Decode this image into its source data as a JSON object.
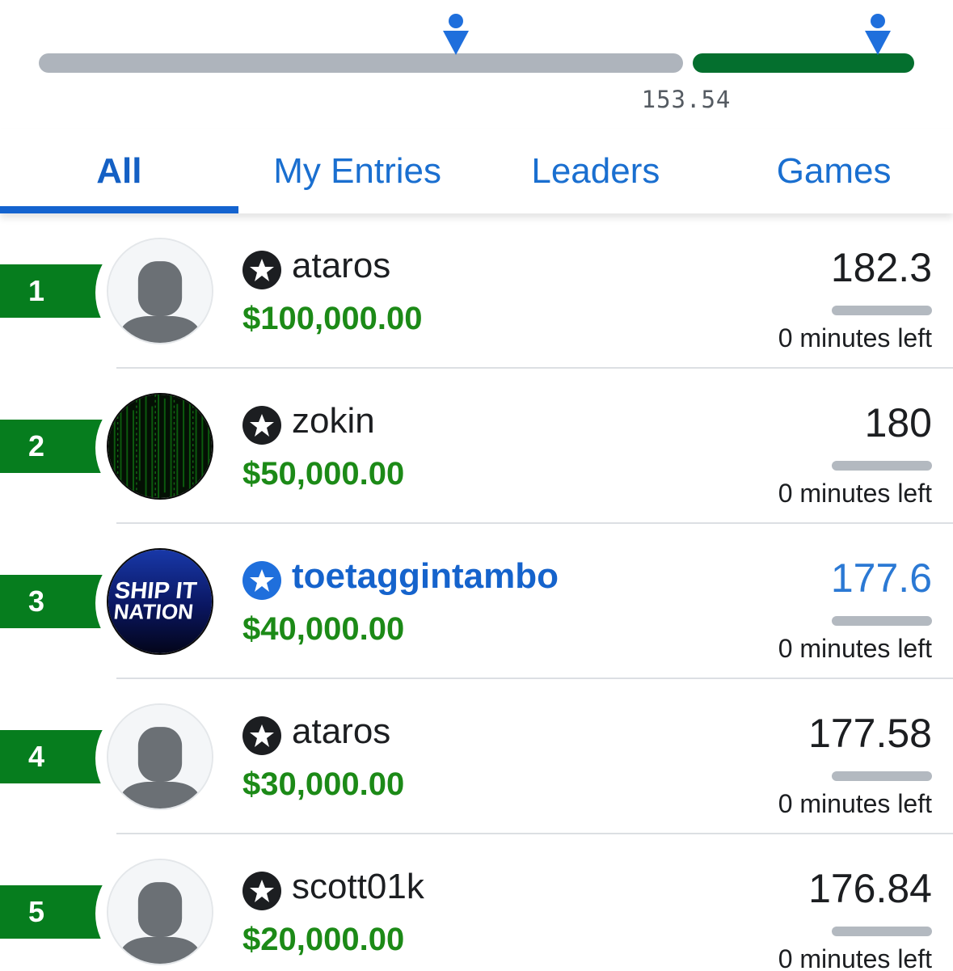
{
  "payout": {
    "threshold_label": "153.54",
    "paid_fraction": 0.255,
    "colors": {
      "unpaid": "#aeb4bc",
      "paid": "#046f2e",
      "marker": "#1f6fdc"
    }
  },
  "tabs": [
    {
      "label": "All",
      "active": true
    },
    {
      "label": "My Entries",
      "active": false
    },
    {
      "label": "Leaders",
      "active": false
    },
    {
      "label": "Games",
      "active": false
    }
  ],
  "entries": [
    {
      "rank": "1",
      "username": "ataros",
      "prize": "$100,000.00",
      "score": "182.3",
      "time_left": "0 minutes left",
      "avatar": "default-avatar",
      "is_me": false
    },
    {
      "rank": "2",
      "username": "zokin",
      "prize": "$50,000.00",
      "score": "180",
      "time_left": "0 minutes left",
      "avatar": "matrix-avatar",
      "is_me": false
    },
    {
      "rank": "3",
      "username": "toetaggintambo",
      "prize": "$40,000.00",
      "score": "177.6",
      "time_left": "0 minutes left",
      "avatar": "ship-it-nation-avatar",
      "avatar_text": [
        "SHIP IT",
        "NATION"
      ],
      "is_me": true
    },
    {
      "rank": "4",
      "username": "ataros",
      "prize": "$30,000.00",
      "score": "177.58",
      "time_left": "0 minutes left",
      "avatar": "default-avatar",
      "is_me": false
    },
    {
      "rank": "5",
      "username": "scott01k",
      "prize": "$20,000.00",
      "score": "176.84",
      "time_left": "0 minutes left",
      "avatar": "default-avatar",
      "is_me": false
    }
  ],
  "colors": {
    "accent": "#1463cf",
    "prize": "#1c8a17",
    "rank_badge": "#067d1e",
    "me_star": "#1f6fdc",
    "star": "#1c1e21"
  }
}
